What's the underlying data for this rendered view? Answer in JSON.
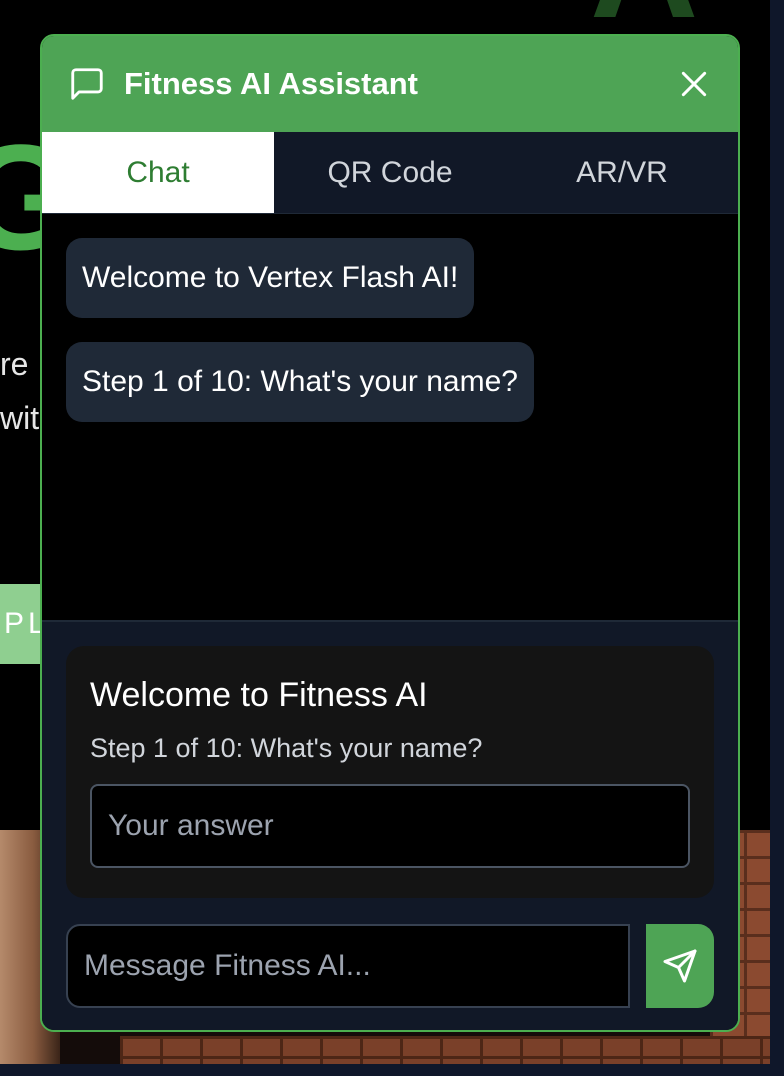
{
  "background": {
    "big_letter": "G",
    "top_letter": "A",
    "text_line_1": "re",
    "text_line_2": "with",
    "button_fragment": "PL"
  },
  "widget": {
    "title": "Fitness AI Assistant",
    "accent_color": "#4ea455",
    "icons": {
      "header": "message-square-icon",
      "close": "close-icon",
      "send": "send-icon"
    },
    "tabs": [
      {
        "label": "Chat",
        "active": true
      },
      {
        "label": "QR Code",
        "active": false
      },
      {
        "label": "AR/VR",
        "active": false
      }
    ],
    "messages": [
      {
        "text": "Welcome to Vertex Flash AI!"
      },
      {
        "text": "Step 1 of 10: What's your name?"
      }
    ],
    "step_card": {
      "title": "Welcome to Fitness AI",
      "question": "Step 1 of 10: What's your name?",
      "answer_value": "",
      "answer_placeholder": "Your answer"
    },
    "composer": {
      "value": "",
      "placeholder": "Message Fitness AI..."
    }
  }
}
